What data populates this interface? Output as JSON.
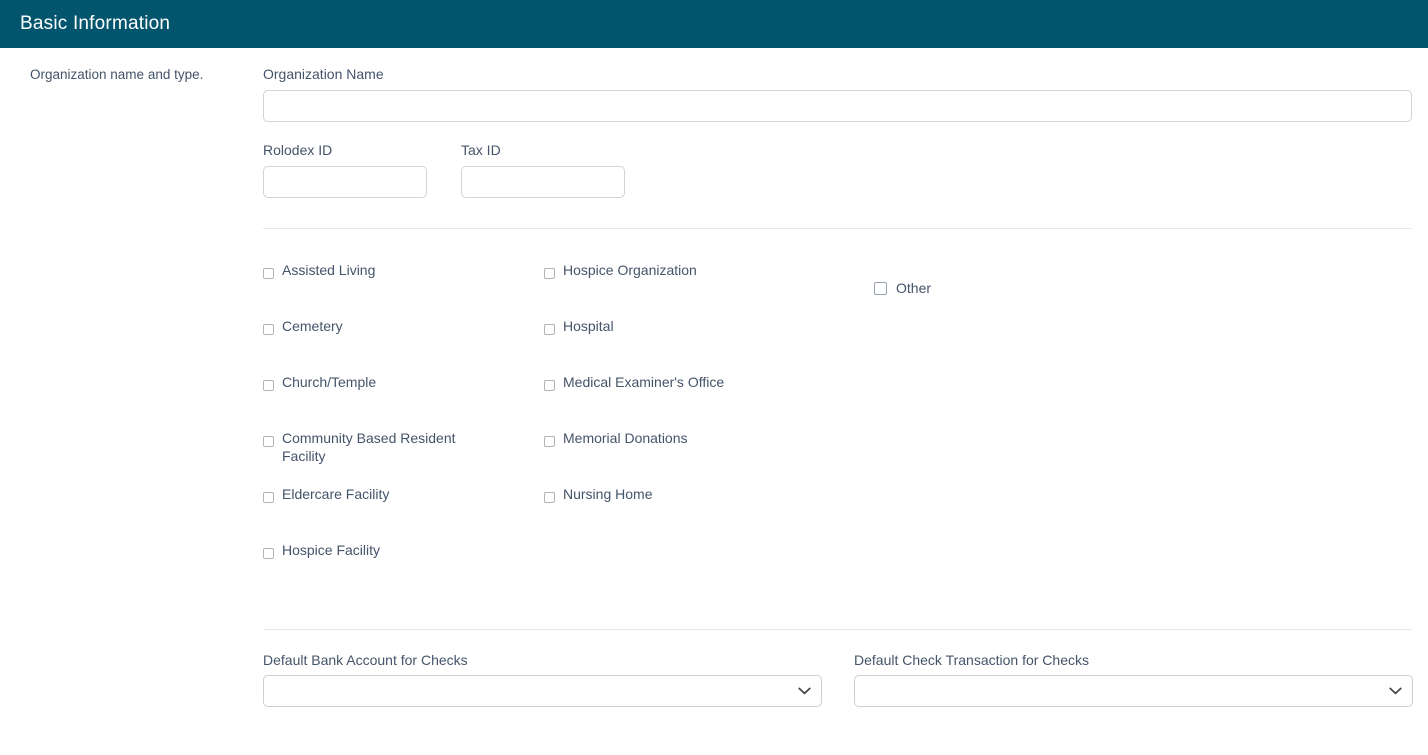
{
  "header": {
    "title": "Basic Information",
    "bg_color": "#03556e",
    "text_color": "#ffffff"
  },
  "description": {
    "text": "Organization name and type."
  },
  "fields": {
    "organization_name": {
      "label": "Organization Name",
      "value": "",
      "placeholder": ""
    },
    "rolodex_id": {
      "label": "Rolodex ID",
      "value": "",
      "placeholder": ""
    },
    "tax_id": {
      "label": "Tax ID",
      "value": "",
      "placeholder": ""
    }
  },
  "org_types": {
    "column_1": [
      {
        "label": "Assisted Living",
        "checked": false
      },
      {
        "label": "Cemetery",
        "checked": false
      },
      {
        "label": "Church/Temple",
        "checked": false
      },
      {
        "label": "Community Based Resident Facility",
        "checked": false
      },
      {
        "label": "Eldercare Facility",
        "checked": false
      },
      {
        "label": "Hospice Facility",
        "checked": false
      }
    ],
    "column_2": [
      {
        "label": "Hospice Organization",
        "checked": false
      },
      {
        "label": "Hospital",
        "checked": false
      },
      {
        "label": "Medical Examiner's Office",
        "checked": false
      },
      {
        "label": "Memorial Donations",
        "checked": false
      },
      {
        "label": "Nursing Home",
        "checked": false
      }
    ],
    "column_3": [
      {
        "label": "Other",
        "checked": false
      }
    ]
  },
  "selects": {
    "default_bank_account": {
      "label": "Default Bank Account for Checks",
      "value": "",
      "icon": "chevron-down-icon"
    },
    "default_check_transaction": {
      "label": "Default Check Transaction for Checks",
      "value": "",
      "icon": "chevron-down-icon"
    }
  },
  "colors": {
    "header_bg": "#03556e",
    "label_text": "#44546a",
    "border": "#d3d3d3",
    "divider": "#e9e9e9"
  }
}
